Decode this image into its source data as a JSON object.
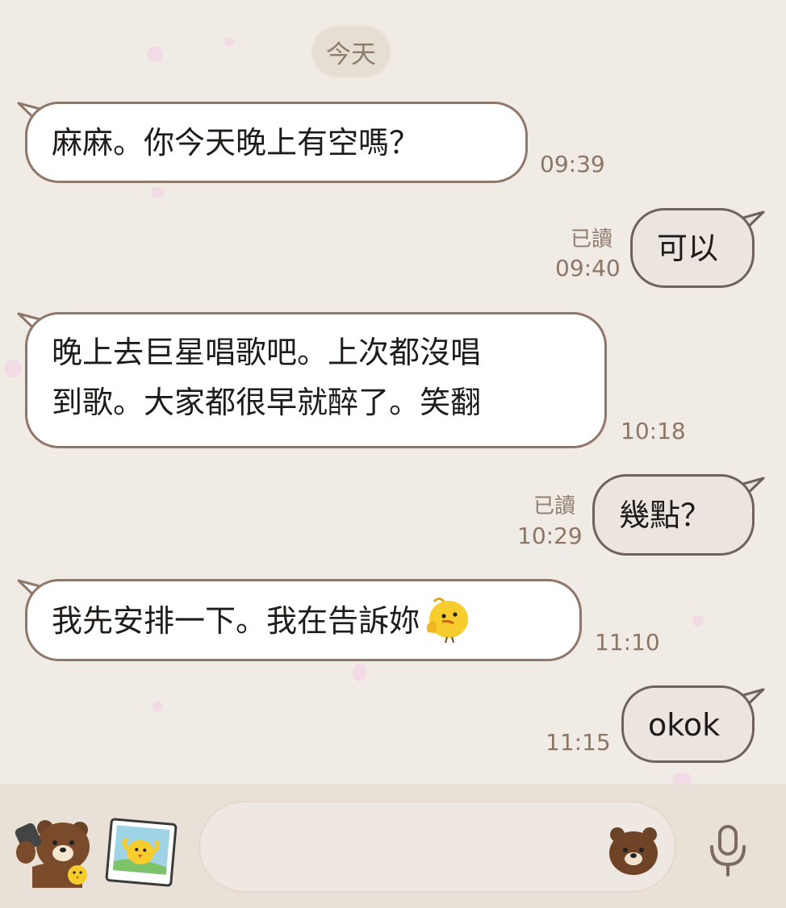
{
  "date_divider": "今天",
  "messages": [
    {
      "direction": "incoming",
      "text": "麻麻。你今天晚上有空嗎？",
      "time": "09:39"
    },
    {
      "direction": "outgoing",
      "text": "可以",
      "time": "09:40",
      "read_label": "已讀"
    },
    {
      "direction": "incoming",
      "lines": [
        "晚上去巨星唱歌吧。上次都沒唱",
        "到歌。大家都很早就醉了。笑翻"
      ],
      "time": "10:18"
    },
    {
      "direction": "outgoing",
      "text": "幾點？",
      "time": "10:29",
      "read_label": "已讀"
    },
    {
      "direction": "incoming",
      "text": "我先安排一下。我在告訴妳",
      "trailing_icon": "thinking-chick-emoji",
      "time": "11:10"
    },
    {
      "direction": "outgoing",
      "text": "okok",
      "time": "11:15"
    }
  ],
  "composer": {
    "input_value": "",
    "icons": [
      "brown-bear-sticker-icon",
      "photo-sticker-icon",
      "bear-emoji-icon",
      "microphone-icon"
    ]
  },
  "colors": {
    "background": "#f1ebe5",
    "incoming_bubble": "#ffffff",
    "outgoing_bubble": "#ece5df",
    "bubble_border": "#8f7769",
    "timestamp": "#8c7666",
    "composer_bar": "#e9e0d7"
  }
}
